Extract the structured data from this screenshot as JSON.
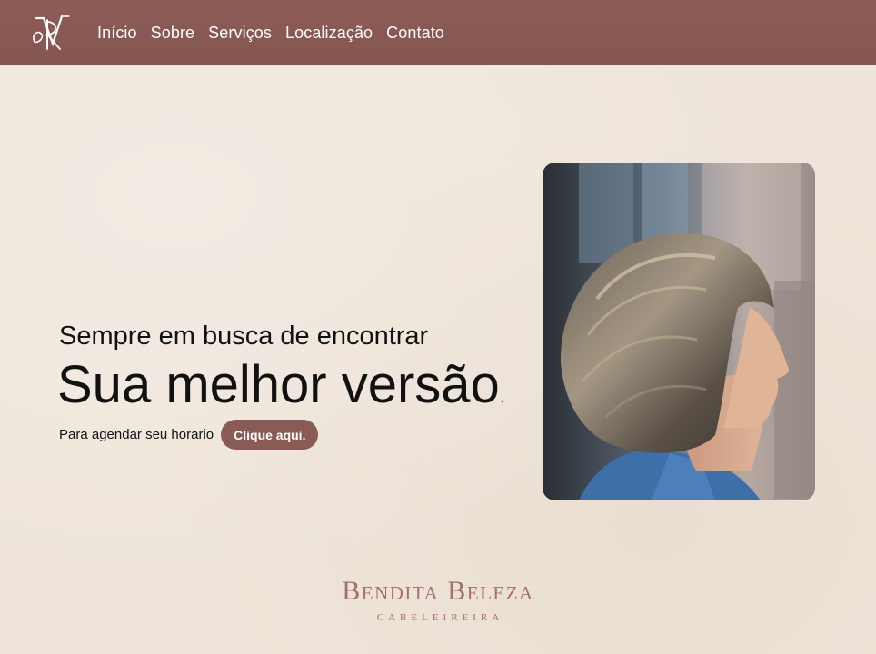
{
  "nav": {
    "logo_icon": "rn-monogram-logo",
    "items": [
      {
        "label": "Início"
      },
      {
        "label": "Sobre"
      },
      {
        "label": "Serviços"
      },
      {
        "label": "Localização"
      },
      {
        "label": "Contato"
      }
    ]
  },
  "hero": {
    "subtitle": "Sempre em busca de encontrar",
    "title": "Sua melhor versão",
    "title_suffix": ".",
    "booking_text": "Para agendar seu horario",
    "cta_label": "Clique aqui."
  },
  "photo": {
    "icon": "hair-model-photo"
  },
  "brand": {
    "name": "Bendita Beleza",
    "tagline": "CABELEIREIRA"
  },
  "colors": {
    "accent": "#8a5a55",
    "background": "#efe5da",
    "brand_text": "#a86f6a"
  }
}
